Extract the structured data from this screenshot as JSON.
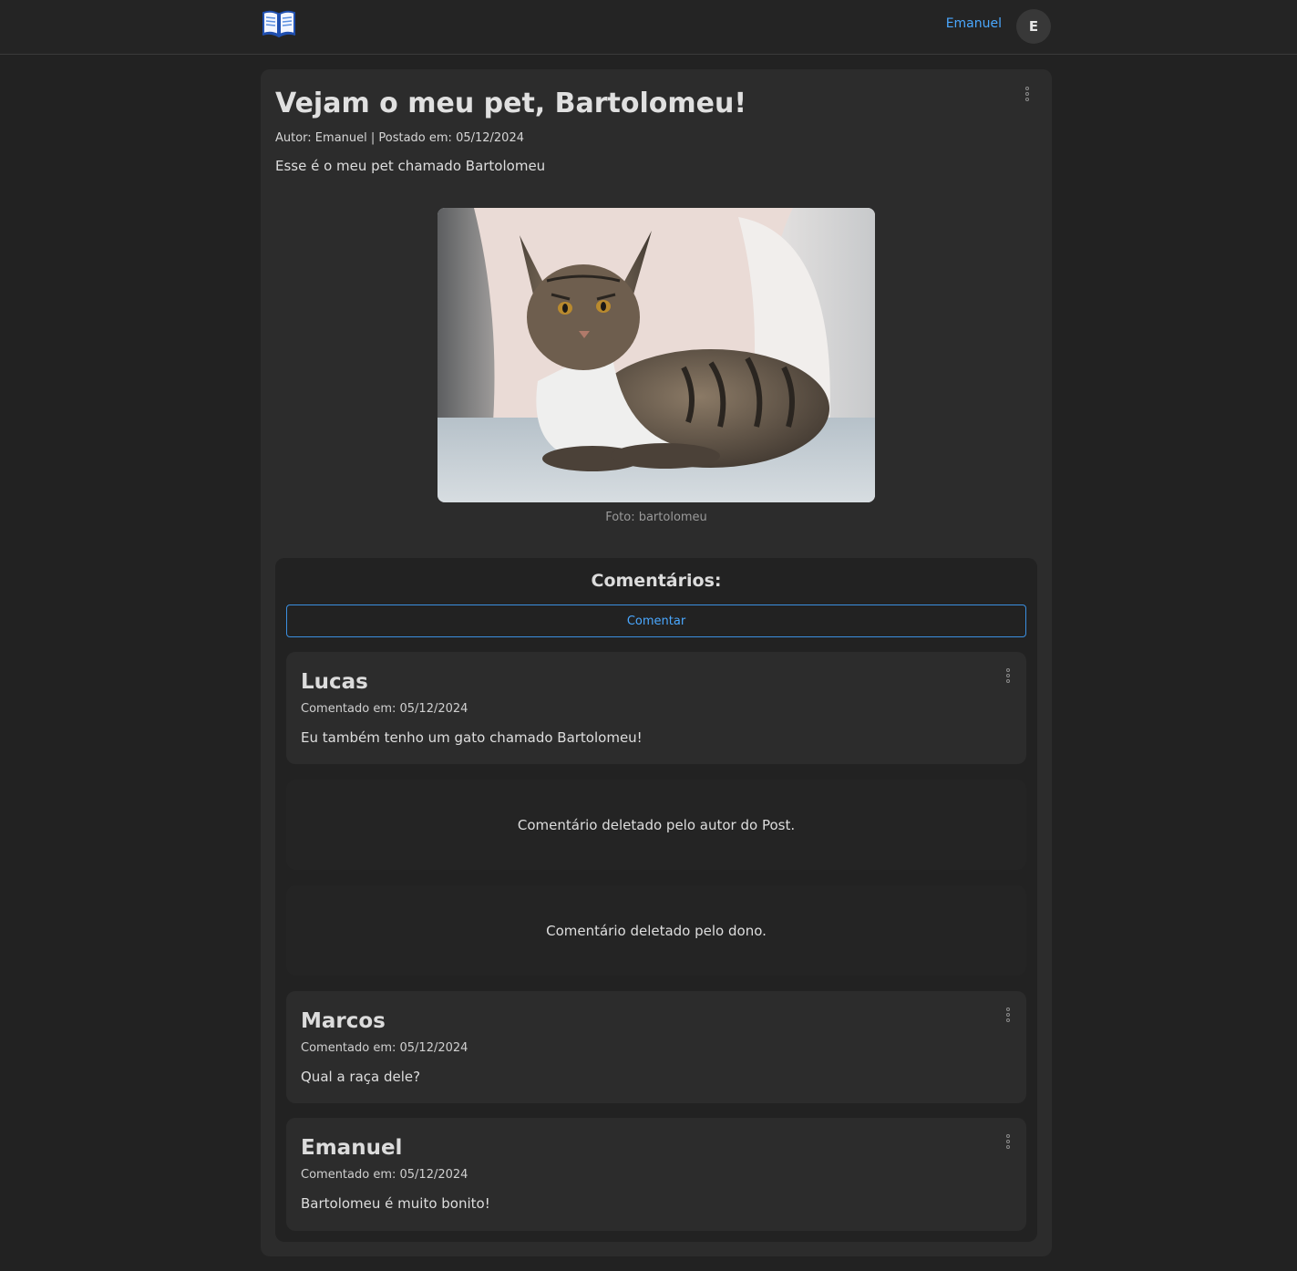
{
  "navbar": {
    "logo_icon": "open-book-icon",
    "username": "Emanuel",
    "avatar_initial": "E"
  },
  "post": {
    "title": "Vejam o meu pet, Bartolomeu!",
    "meta": "Autor: Emanuel | Postado em: 05/12/2024",
    "body": "Esse é o meu pet chamado Bartolomeu",
    "image_description": "tabby cat lying on a couch",
    "photo_caption": "Foto: bartolomeu",
    "menu_icon": "kebab-menu-icon"
  },
  "comments": {
    "heading": "Comentários:",
    "button_label": "Comentar",
    "items": [
      {
        "type": "comment",
        "author": "Lucas",
        "date": "Comentado em: 05/12/2024",
        "text": "Eu também tenho um gato chamado Bartolomeu!"
      },
      {
        "type": "deleted",
        "text": "Comentário deletado pelo autor do Post."
      },
      {
        "type": "deleted",
        "text": "Comentário deletado pelo dono."
      },
      {
        "type": "comment",
        "author": "Marcos",
        "date": "Comentado em: 05/12/2024",
        "text": "Qual a raça dele?"
      },
      {
        "type": "comment",
        "author": "Emanuel",
        "date": "Comentado em: 05/12/2024",
        "text": "Bartolomeu é muito bonito!"
      }
    ]
  },
  "colors": {
    "page_background": "#222222",
    "card_background": "#2c2c2c",
    "accent": "#4aa8ff"
  }
}
